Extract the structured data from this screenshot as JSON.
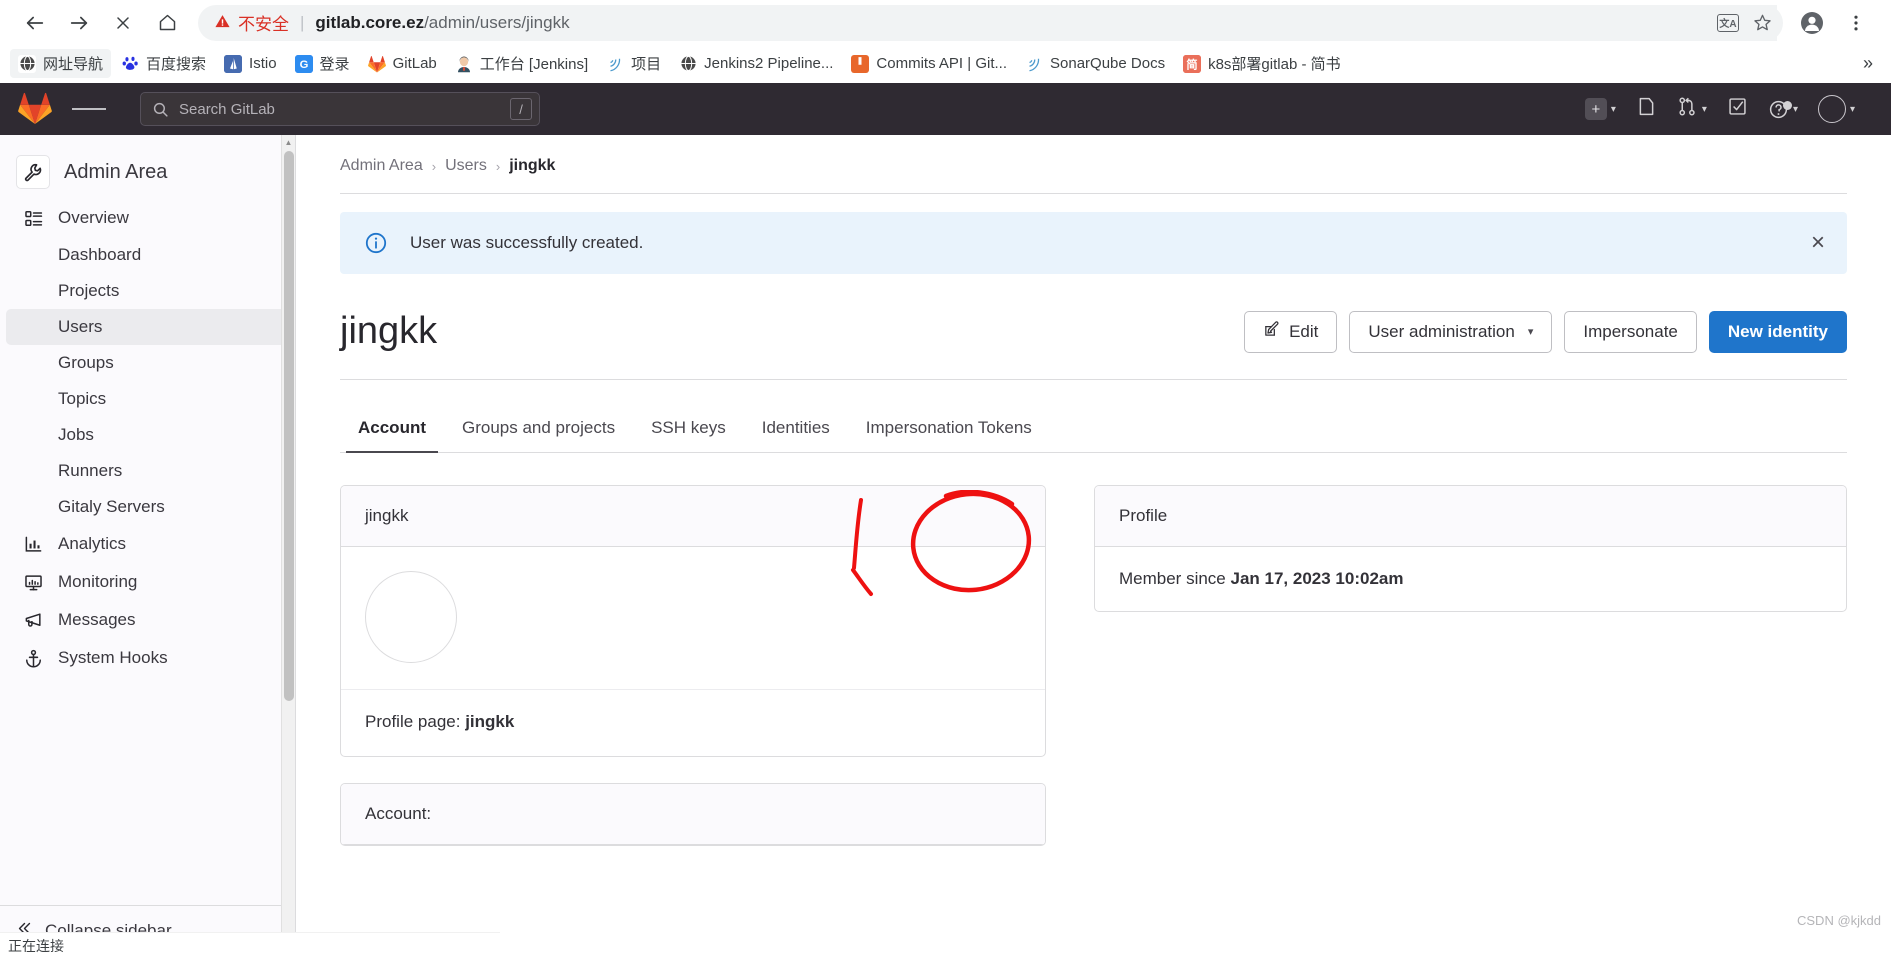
{
  "browser": {
    "nav": {
      "back": "back-arrow",
      "forward": "forward-arrow",
      "stop": "stop-x",
      "home": "home"
    },
    "omnibox": {
      "security_warning": "不安全",
      "url_host": "gitlab.core.ez",
      "url_path": "/admin/users/jingkk",
      "translate_label": "文A",
      "bookmark_icon": "star-icon",
      "profile_icon": "account-icon",
      "menu_icon": "kebab-menu-icon"
    },
    "bookmarks": [
      {
        "label": "网址导航",
        "icon": "globe-icon",
        "glyph": "🌐"
      },
      {
        "label": "百度搜索",
        "icon": "baidu-icon",
        "glyph": "熊"
      },
      {
        "label": "Istio",
        "icon": "istio-icon",
        "glyph": "▲"
      },
      {
        "label": "登录",
        "icon": "google-icon",
        "glyph": "G"
      },
      {
        "label": "GitLab",
        "icon": "gitlab-icon",
        "glyph": "▼"
      },
      {
        "label": "工作台 [Jenkins]",
        "icon": "jenkins-icon",
        "glyph": "☺"
      },
      {
        "label": "项目",
        "icon": "sonar-icon",
        "glyph": ")"
      },
      {
        "label": "Jenkins2 Pipeline...",
        "icon": "globe-icon",
        "glyph": "🌐"
      },
      {
        "label": "Commits API | Git...",
        "icon": "book-icon",
        "glyph": "■"
      },
      {
        "label": "SonarQube Docs",
        "icon": "sonar-icon",
        "glyph": ")"
      },
      {
        "label": "k8s部署gitlab - 简书",
        "icon": "jianshu-icon",
        "glyph": "简"
      }
    ],
    "bookmarks_overflow": "»",
    "status_text": "正在连接"
  },
  "gitlab_nav": {
    "logo": "gitlab-logo",
    "hamburger": "hamburger-menu-icon",
    "search_placeholder": "Search GitLab",
    "search_shortcut": "/",
    "right_items": [
      {
        "name": "create-new-menu",
        "icon": "plus-square-icon",
        "caret": true
      },
      {
        "name": "issues-link",
        "icon": "issues-icon",
        "caret": false
      },
      {
        "name": "merge-requests-menu",
        "icon": "merge-request-icon",
        "caret": true
      },
      {
        "name": "todos-link",
        "icon": "todo-checkbox-icon",
        "caret": false
      },
      {
        "name": "help-menu",
        "icon": "question-circle-icon",
        "caret": true
      },
      {
        "name": "user-menu",
        "icon": "avatar-icon",
        "caret": true
      }
    ]
  },
  "sidebar": {
    "header": {
      "label": "Admin Area",
      "icon": "wrench-icon"
    },
    "items": [
      {
        "label": "Overview",
        "icon": "overview-icon",
        "type": "group",
        "active": false
      },
      {
        "label": "Dashboard",
        "type": "sub",
        "active": false
      },
      {
        "label": "Projects",
        "type": "sub",
        "active": false
      },
      {
        "label": "Users",
        "type": "sub",
        "active": true
      },
      {
        "label": "Groups",
        "type": "sub",
        "active": false
      },
      {
        "label": "Topics",
        "type": "sub",
        "active": false
      },
      {
        "label": "Jobs",
        "type": "sub",
        "active": false
      },
      {
        "label": "Runners",
        "type": "sub",
        "active": false
      },
      {
        "label": "Gitaly Servers",
        "type": "sub",
        "active": false
      },
      {
        "label": "Analytics",
        "icon": "analytics-icon",
        "type": "group",
        "active": false
      },
      {
        "label": "Monitoring",
        "icon": "monitor-icon",
        "type": "group",
        "active": false
      },
      {
        "label": "Messages",
        "icon": "megaphone-icon",
        "type": "group",
        "active": false
      },
      {
        "label": "System Hooks",
        "icon": "anchor-icon",
        "type": "group",
        "active": false
      }
    ],
    "collapse_label": "Collapse sidebar",
    "collapse_icon": "chevron-double-left-icon"
  },
  "main": {
    "breadcrumb": [
      {
        "label": "Admin Area",
        "current": false
      },
      {
        "label": "Users",
        "current": false
      },
      {
        "label": "jingkk",
        "current": true
      }
    ],
    "breadcrumb_separator": "›",
    "alert": {
      "icon": "info-circle-icon",
      "message": "User was successfully created.",
      "close_icon": "close-icon",
      "close_glyph": "×",
      "background": "#e9f3fc",
      "icon_color": "#1f75cb"
    },
    "page_title": "jingkk",
    "actions": {
      "edit": {
        "label": "Edit",
        "icon": "pencil-square-icon"
      },
      "user_administration": {
        "label": "User administration",
        "caret": "∨"
      },
      "impersonate": {
        "label": "Impersonate"
      },
      "new_identity": {
        "label": "New identity",
        "color": "#1f75cb"
      }
    },
    "tabs": [
      {
        "label": "Account",
        "active": true
      },
      {
        "label": "Groups and projects",
        "active": false
      },
      {
        "label": "SSH keys",
        "active": false
      },
      {
        "label": "Identities",
        "active": false
      },
      {
        "label": "Impersonation Tokens",
        "active": false
      }
    ],
    "user_card": {
      "header": "jingkk",
      "avatar": "user-avatar-placeholder",
      "profile_page_label": "Profile page:",
      "profile_page_value": "jingkk"
    },
    "account_card": {
      "header": "Account:"
    },
    "profile_card": {
      "header": "Profile",
      "member_since_label": "Member since",
      "member_since_value": "Jan 17, 2023 10:02am"
    }
  },
  "watermark": "CSDN @kjkdd"
}
